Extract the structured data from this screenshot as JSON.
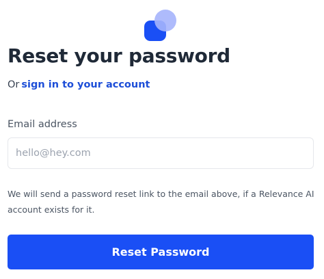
{
  "brand": {
    "logo_icon": "relevance-ai-logo-icon",
    "primary_color": "#1a4ff5",
    "secondary_color": "#a5b4fc"
  },
  "page": {
    "title": "Reset your password",
    "subtitle_prefix": "Or",
    "signin_link_label": "sign in to your account"
  },
  "form": {
    "email_label": "Email address",
    "email_placeholder": "hello@hey.com",
    "email_value": "",
    "helper_text": "We will send a password reset link to the email above, if a Relevance AI account exists for it.",
    "submit_label": "Reset Password"
  }
}
